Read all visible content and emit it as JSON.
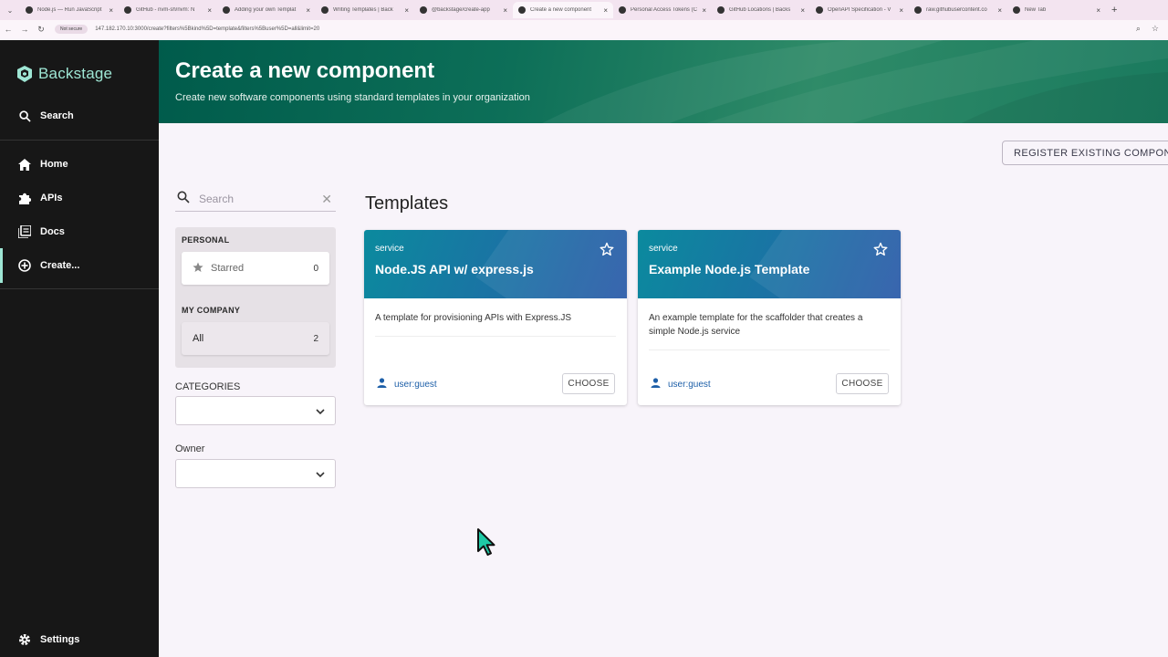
{
  "browser": {
    "tabs": [
      {
        "title": "Node.js — Run JavaScript",
        "active": false
      },
      {
        "title": "GitHub - nvm-sh/nvm: N",
        "active": false
      },
      {
        "title": "Adding your own Templat",
        "active": false
      },
      {
        "title": "Writing Templates | Back",
        "active": false
      },
      {
        "title": "@backstage/create-app",
        "active": false
      },
      {
        "title": "Create a new component",
        "active": true
      },
      {
        "title": "Personal Access Tokens (C",
        "active": false
      },
      {
        "title": "GitHub Locations | Backs",
        "active": false
      },
      {
        "title": "OpenAPI Specification - V",
        "active": false
      },
      {
        "title": "raw.githubusercontent.co",
        "active": false
      },
      {
        "title": "New Tab",
        "active": false
      }
    ],
    "security_label": "Not secure",
    "url": "147.182.170.10:3000/create?filters%5Bkind%5D=template&filters%5Buser%5D=all&limit=20"
  },
  "sidebar": {
    "brand": "Backstage",
    "search_label": "Search",
    "items": [
      {
        "label": "Home",
        "icon": "home-icon"
      },
      {
        "label": "APIs",
        "icon": "puzzle-icon"
      },
      {
        "label": "Docs",
        "icon": "library-icon"
      },
      {
        "label": "Create...",
        "icon": "add-circle-icon",
        "active": true
      }
    ],
    "settings_label": "Settings"
  },
  "header": {
    "title": "Create a new component",
    "subtitle": "Create new software components using standard templates in your organization"
  },
  "register_button": "REGISTER EXISTING COMPONENT",
  "filters": {
    "search_placeholder": "Search",
    "personal_heading": "PERSONAL",
    "starred": {
      "label": "Starred",
      "count": "0"
    },
    "company_heading": "MY COMPANY",
    "all": {
      "label": "All",
      "count": "2"
    },
    "categories_label": "CATEGORIES",
    "owner_label": "Owner"
  },
  "templates": {
    "heading": "Templates",
    "cards": [
      {
        "kind": "service",
        "title": "Node.JS API w/ express.js",
        "description": "A template for provisioning APIs with Express.JS",
        "owner": "user:guest",
        "action": "CHOOSE"
      },
      {
        "kind": "service",
        "title": "Example Node.js Template",
        "description": "An example template for the scaffolder that creates a simple Node.js service",
        "owner": "user:guest",
        "action": "CHOOSE"
      }
    ]
  },
  "colors": {
    "sidebar_bg": "#171717",
    "brand_accent": "#9ee6d4",
    "header_green": "#0d6f58",
    "card_blue": "#1d6fa5",
    "link_blue": "#1d5fa8"
  }
}
